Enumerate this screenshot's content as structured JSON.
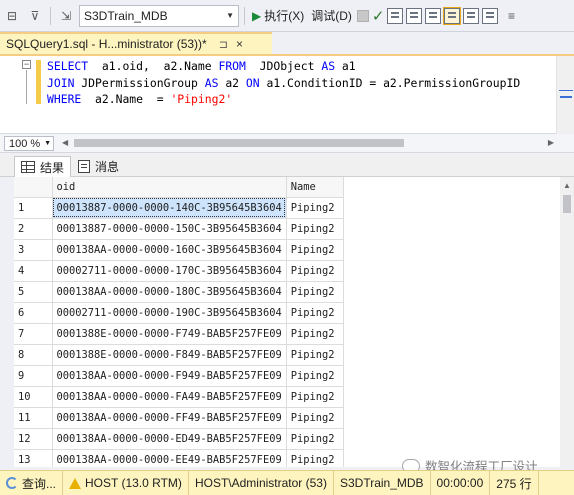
{
  "toolbar": {
    "database": "S3DTrain_MDB",
    "execute_label": "执行(X)",
    "debug_label": "调试(D)"
  },
  "tab": {
    "title": "SQLQuery1.sql - H...ministrator (53))*",
    "pin": "⊐",
    "close": "×"
  },
  "editor": {
    "line1": {
      "kw1": "SELECT",
      "t1": "  a1.oid,  a2.Name ",
      "kw2": "FROM",
      "t2": "  JDObject ",
      "kw3": "AS",
      "t3": " a1"
    },
    "line2": {
      "kw1": "JOIN",
      "t1": " JDPermissionGroup ",
      "kw2": "AS",
      "t2": " a2 ",
      "kw3": "ON",
      "t3": " a1.ConditionID = a2.PermissionGroupID"
    },
    "line3": {
      "kw1": "WHERE",
      "t1": "  a2.Name  = ",
      "str": "'Piping2'"
    }
  },
  "zoom": {
    "value": "100 %"
  },
  "result_tabs": {
    "results": "结果",
    "messages": "消息"
  },
  "grid": {
    "columns": [
      "oid",
      "Name"
    ],
    "rows": [
      {
        "n": "1",
        "oid": "00013887-0000-0000-140C-3B95645B3604",
        "name": "Piping2"
      },
      {
        "n": "2",
        "oid": "00013887-0000-0000-150C-3B95645B3604",
        "name": "Piping2"
      },
      {
        "n": "3",
        "oid": "000138AA-0000-0000-160C-3B95645B3604",
        "name": "Piping2"
      },
      {
        "n": "4",
        "oid": "00002711-0000-0000-170C-3B95645B3604",
        "name": "Piping2"
      },
      {
        "n": "5",
        "oid": "000138AA-0000-0000-180C-3B95645B3604",
        "name": "Piping2"
      },
      {
        "n": "6",
        "oid": "00002711-0000-0000-190C-3B95645B3604",
        "name": "Piping2"
      },
      {
        "n": "7",
        "oid": "0001388E-0000-0000-F749-BAB5F257FE09",
        "name": "Piping2"
      },
      {
        "n": "8",
        "oid": "0001388E-0000-0000-F849-BAB5F257FE09",
        "name": "Piping2"
      },
      {
        "n": "9",
        "oid": "000138AA-0000-0000-F949-BAB5F257FE09",
        "name": "Piping2"
      },
      {
        "n": "10",
        "oid": "000138AA-0000-0000-FA49-BAB5F257FE09",
        "name": "Piping2"
      },
      {
        "n": "11",
        "oid": "000138AA-0000-0000-FF49-BAB5F257FE09",
        "name": "Piping2"
      },
      {
        "n": "12",
        "oid": "000138AA-0000-0000-ED49-BAB5F257FE09",
        "name": "Piping2"
      },
      {
        "n": "13",
        "oid": "000138AA-0000-0000-EE49-BAB5F257FE09",
        "name": "Piping2"
      }
    ]
  },
  "status": {
    "state": "查询...",
    "host": "HOST (13.0 RTM)",
    "user": "HOST\\Administrator (53)",
    "db": "S3DTrain_MDB",
    "time": "00:00:00",
    "rows": "275 行"
  },
  "watermark": "数智化流程工厂设计",
  "colors": {
    "tab_bg": "#fdf4bf",
    "keyword": "#0000ff",
    "string": "#ff0000",
    "selection": "#cde4fc"
  }
}
